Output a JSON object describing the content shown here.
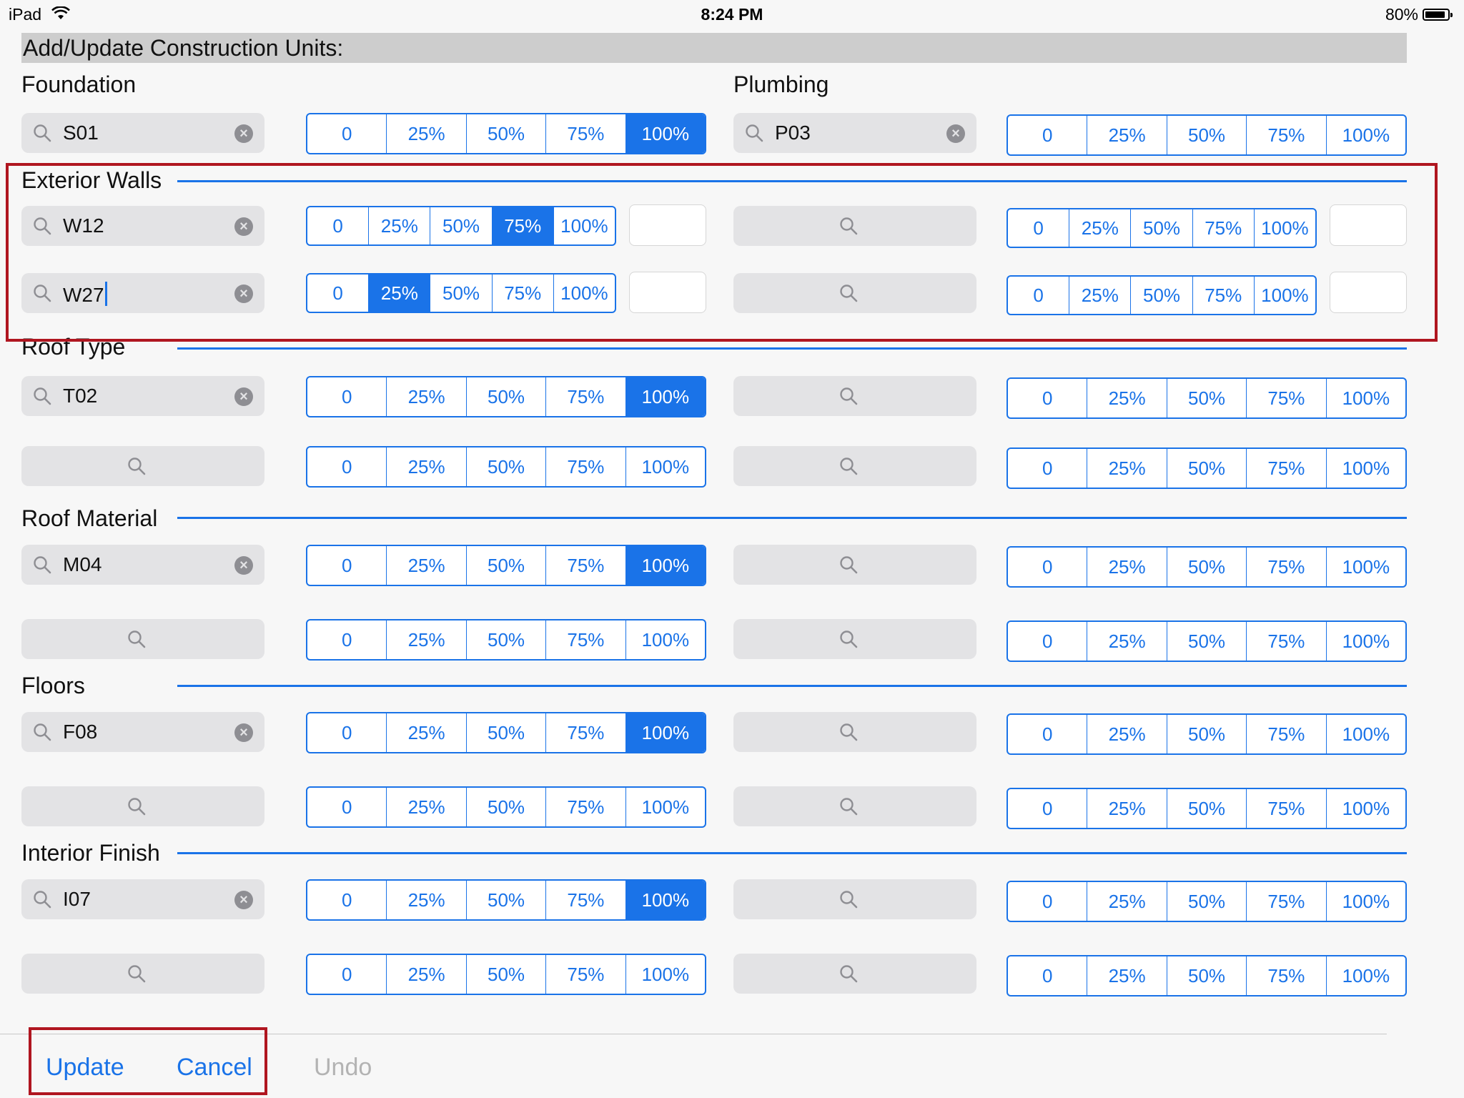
{
  "status_bar": {
    "device": "iPad",
    "time": "8:24 PM",
    "battery": "80%"
  },
  "header": {
    "title": "Add/Update Construction Units:"
  },
  "segment_options": [
    "0",
    "25%",
    "50%",
    "75%",
    "100%"
  ],
  "sections": {
    "foundation": {
      "title": "Foundation",
      "rows": [
        {
          "code": "S01"
        }
      ]
    },
    "plumbing": {
      "title": "Plumbing",
      "rows": [
        {
          "code": "P03"
        }
      ]
    },
    "exterior_walls": {
      "title": "Exterior Walls",
      "rows": [
        {
          "code": "W12"
        },
        {
          "code": "W27"
        }
      ]
    },
    "roof_type": {
      "title": "Roof Type",
      "rows": [
        {
          "code": "T02"
        }
      ]
    },
    "roof_material": {
      "title": "Roof Material",
      "rows": [
        {
          "code": "M04"
        }
      ]
    },
    "floors": {
      "title": "Floors",
      "rows": [
        {
          "code": "F08"
        }
      ]
    },
    "interior_finish": {
      "title": "Interior Finish",
      "rows": [
        {
          "code": "I07"
        }
      ]
    }
  },
  "toolbar": {
    "update": "Update",
    "cancel": "Cancel",
    "undo": "Undo"
  },
  "colors": {
    "accent": "#1a73e8",
    "highlight": "#b01620"
  }
}
